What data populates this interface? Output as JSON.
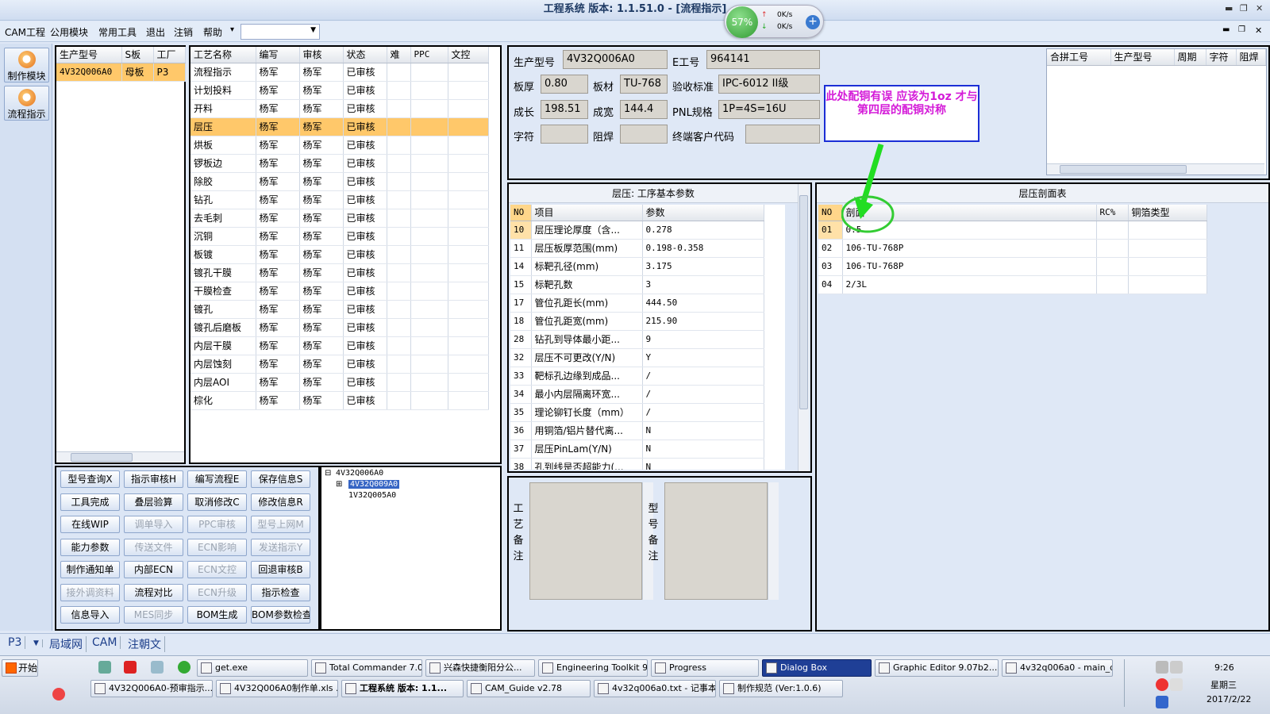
{
  "window": {
    "title": "工程系统  版本: 1.1.51.0 - [流程指示]",
    "min": "▬",
    "restore": "❐",
    "close": "✕"
  },
  "menu": {
    "items": [
      "CAM工程",
      "公用模块",
      "常用工具",
      "退出",
      "注销",
      "帮助"
    ],
    "dropdown_arrow": "▾",
    "combo_value": "",
    "mdi_min": "▬",
    "mdi_restore": "❐",
    "mdi_close": "✕"
  },
  "meter": {
    "percent": "57%",
    "up": "0K/s",
    "down": "0K/s",
    "plus": "+"
  },
  "leftnav": {
    "items": [
      "制作模块",
      "流程指示"
    ]
  },
  "model_table": {
    "headers": [
      "生产型号",
      "S板",
      "工厂"
    ],
    "rows": [
      [
        "4V32Q006A0",
        "母板",
        "P3"
      ]
    ]
  },
  "process_table": {
    "headers": [
      "工艺名称",
      "编写",
      "审核",
      "状态",
      "难",
      "PPC",
      "文控"
    ],
    "rows": [
      [
        "流程指示",
        "杨军",
        "杨军",
        "已审核"
      ],
      [
        "计划投料",
        "杨军",
        "杨军",
        "已审核"
      ],
      [
        "开料",
        "杨军",
        "杨军",
        "已审核"
      ],
      [
        "层压",
        "杨军",
        "杨军",
        "已审核"
      ],
      [
        "烘板",
        "杨军",
        "杨军",
        "已审核"
      ],
      [
        "锣板边",
        "杨军",
        "杨军",
        "已审核"
      ],
      [
        "除胶",
        "杨军",
        "杨军",
        "已审核"
      ],
      [
        "钻孔",
        "杨军",
        "杨军",
        "已审核"
      ],
      [
        "去毛刺",
        "杨军",
        "杨军",
        "已审核"
      ],
      [
        "沉铜",
        "杨军",
        "杨军",
        "已审核"
      ],
      [
        "板镀",
        "杨军",
        "杨军",
        "已审核"
      ],
      [
        "镀孔干膜",
        "杨军",
        "杨军",
        "已审核"
      ],
      [
        "干膜检查",
        "杨军",
        "杨军",
        "已审核"
      ],
      [
        "镀孔",
        "杨军",
        "杨军",
        "已审核"
      ],
      [
        "镀孔后磨板",
        "杨军",
        "杨军",
        "已审核"
      ],
      [
        "内层干膜",
        "杨军",
        "杨军",
        "已审核"
      ],
      [
        "内层蚀刻",
        "杨军",
        "杨军",
        "已审核"
      ],
      [
        "内层AOI",
        "杨军",
        "杨军",
        "已审核"
      ],
      [
        "棕化",
        "杨军",
        "杨军",
        "已审核"
      ]
    ],
    "selected_index": 3
  },
  "buttons": [
    {
      "label": "型号查询X",
      "enabled": true
    },
    {
      "label": "指示审核H",
      "enabled": true
    },
    {
      "label": "编写流程E",
      "enabled": true
    },
    {
      "label": "保存信息S",
      "enabled": true
    },
    {
      "label": "工具完成",
      "enabled": true
    },
    {
      "label": "叠层验算",
      "enabled": true
    },
    {
      "label": "取消修改C",
      "enabled": true
    },
    {
      "label": "修改信息R",
      "enabled": true
    },
    {
      "label": "在线WIP",
      "enabled": true
    },
    {
      "label": "调单导入",
      "enabled": false
    },
    {
      "label": "PPC审核",
      "enabled": false
    },
    {
      "label": "型号上网M",
      "enabled": false
    },
    {
      "label": "能力参数",
      "enabled": true
    },
    {
      "label": "传送文件",
      "enabled": false
    },
    {
      "label": "ECN影响",
      "enabled": false
    },
    {
      "label": "发送指示Y",
      "enabled": false
    },
    {
      "label": "制作通知单",
      "enabled": true
    },
    {
      "label": "内部ECN",
      "enabled": true
    },
    {
      "label": "ECN文控",
      "enabled": false
    },
    {
      "label": "回退审核B",
      "enabled": true
    },
    {
      "label": "接外调资料",
      "enabled": false
    },
    {
      "label": "流程对比",
      "enabled": true
    },
    {
      "label": "ECN升级",
      "enabled": false
    },
    {
      "label": "指示检查",
      "enabled": true
    },
    {
      "label": "信息导入",
      "enabled": true
    },
    {
      "label": "MES同步",
      "enabled": false
    },
    {
      "label": "BOM生成",
      "enabled": true
    },
    {
      "label": "BOM参数检查",
      "enabled": true
    }
  ],
  "tree": {
    "root": "4V32Q006A0",
    "expand": "⊟",
    "expand_child": "⊞",
    "children": [
      "4V32Q009A0",
      "1V32Q005A0"
    ]
  },
  "info": {
    "labels": {
      "model": "生产型号",
      "eno": "E工号",
      "thick": "板厚",
      "material": "板材",
      "standard": "验收标准",
      "grow": "成长",
      "width": "成宽",
      "pnl": "PNL规格",
      "char": "字符",
      "mask": "阻焊",
      "customer": "终端客户代码"
    },
    "values": {
      "model": "4V32Q006A0",
      "eno": "964141",
      "thick": "0.80",
      "material": "TU-768",
      "standard": "IPC-6012 II级",
      "grow": "198.51",
      "width": "144.4",
      "pnl": "1P=4S=16U",
      "char": "",
      "mask": "",
      "customer": ""
    }
  },
  "merge_table": {
    "headers": [
      "合拼工号",
      "生产型号",
      "周期",
      "字符",
      "阻焊"
    ]
  },
  "annotation": "此处配铜有误  应该为1oz  才与第四层的配铜对称",
  "params": {
    "title": "层压: 工序基本参数",
    "headers": [
      "NO",
      "项目",
      "参数"
    ],
    "rows": [
      [
        "10",
        "层压理论厚度（含...",
        "0.278"
      ],
      [
        "11",
        "层压板厚范围(mm)",
        "0.198-0.358"
      ],
      [
        "14",
        "标靶孔径(mm)",
        "3.175"
      ],
      [
        "15",
        "标靶孔数",
        "3"
      ],
      [
        "17",
        "管位孔距长(mm)",
        "444.50"
      ],
      [
        "18",
        "管位孔距宽(mm)",
        "215.90"
      ],
      [
        "28",
        "钻孔到导体最小距...",
        "9"
      ],
      [
        "32",
        "层压不可更改(Y/N)",
        "Y"
      ],
      [
        "33",
        "靶标孔边缘到成品...",
        "/"
      ],
      [
        "34",
        "最小内层隔离环宽...",
        "/"
      ],
      [
        "35",
        "理论铆钉长度（mm）",
        "/"
      ],
      [
        "36",
        "用铜箔/铝片替代离...",
        "N"
      ],
      [
        "37",
        "层压PinLam(Y/N)",
        "N"
      ],
      [
        "38",
        "孔到线是否超能力(...",
        "N"
      ]
    ]
  },
  "stackup": {
    "title": "层压剖面表",
    "headers": [
      "NO",
      "剖面",
      "RC%",
      "铜箔类型"
    ],
    "rows": [
      [
        "01",
        "0.5",
        "",
        ""
      ],
      [
        "02",
        "106-TU-768P",
        "",
        ""
      ],
      [
        "03",
        "106-TU-768P",
        "",
        ""
      ],
      [
        "04",
        "2/3L",
        "",
        ""
      ]
    ]
  },
  "remarks": {
    "process": "工艺备注",
    "model": "型号备注"
  },
  "status": {
    "combo": "P3",
    "tabs": [
      "局域网",
      "CAM",
      "注朝文"
    ]
  },
  "taskbar": {
    "start": "开始",
    "row1": [
      "get.exe",
      "Total Commander 7.0...",
      "兴森快捷衡阳分公...",
      "Engineering Toolkit 9....",
      "Progress",
      "Dialog Box",
      "Graphic Editor 9.07b2...",
      "4v32q006a0 - main_qa"
    ],
    "row2": [
      "4V32Q006A0-预审指示....",
      "4V32Q006A0制作单.xls ...",
      "工程系统  版本: 1.1...",
      "CAM_Guide v2.78",
      "4v32q006a0.txt - 记事本",
      "制作规范 (Ver:1.0.6)"
    ],
    "active": "Dialog Box",
    "clock": {
      "time": "9:26",
      "weekday": "星期三",
      "date": "2017/2/22"
    }
  },
  "colors": {
    "selected_row": "#ffc86a",
    "annotation_border": "#1b2ed6",
    "annotation_text": "#d41bd8",
    "arrow": "#22dd22",
    "active_task": "#1f3f96"
  }
}
